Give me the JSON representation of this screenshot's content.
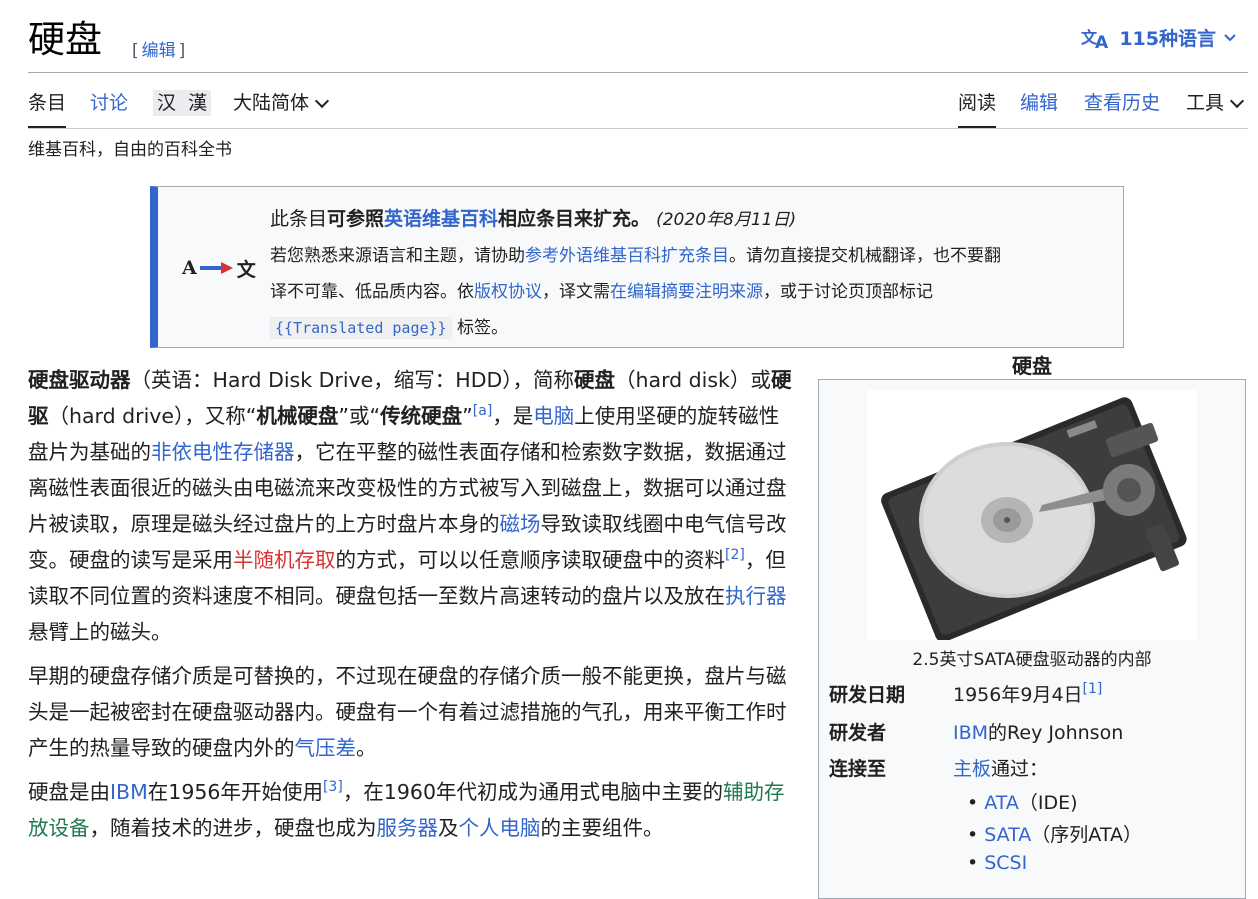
{
  "header": {
    "title": "硬盘",
    "edit_open": "[",
    "edit_label": "编辑",
    "edit_close": "]",
    "languages": "115种语言"
  },
  "tabs": {
    "article": "条目",
    "talk": "讨论",
    "variant_simplified": "汉",
    "variant_traditional": "漢",
    "variant_select": "大陆简体",
    "read": "阅读",
    "edit": "编辑",
    "history": "查看历史",
    "tools": "工具"
  },
  "tagline": "维基百科，自由的百科全书",
  "notice": {
    "icon_a": "A",
    "icon_zh": "文",
    "t1": "此条目",
    "t2": "可参照",
    "t3": "英语维基百科",
    "t4": "相应条目来扩充。",
    "date": "(2020年8月11日)",
    "l1a": "若您熟悉来源语言和主题，请协助",
    "l1b": "参考外语维基百科扩充条目",
    "l1c": "。请勿直接提交机械翻译，也不要翻",
    "l2a": "译不可靠、低品质内容。依",
    "l2b": "版权协议",
    "l2c": "，译文需",
    "l2d": "在编辑摘要注明来源",
    "l2e": "，或于讨论页顶部标记",
    "code": "{{Translated page}}",
    "l3": " 标签。"
  },
  "article": {
    "p1": {
      "a": "硬盘驱动器",
      "b": "（英语：Hard Disk Drive，缩写：HDD），简称",
      "c": "硬盘",
      "d": "（hard disk）或",
      "e": "硬驱",
      "f": "（hard drive），又称“",
      "g": "机械硬盘",
      "h": "”或“",
      "i": "传统硬盘",
      "j": "”",
      "note_a": "[a]",
      "k": "，是",
      "link_computer": "电脑",
      "l": "上使用坚硬的旋转磁性盘片为基础的",
      "link_nvm": "非依电性存储器",
      "m": "，它在平整的磁性表面存储和检索数字数据，数据通过离磁性表面很近的磁头由电磁流来改变极性的方式被写入到磁盘上，数据可以通过盘片被读取，原理是磁头经过盘片的上方时盘片本身的",
      "link_field": "磁场",
      "n": "导致读取线圈中电气信号改变。硬盘的读写是采用",
      "link_sram": "半随机存取",
      "o": "的方式，可以以任意顺序读取硬盘中的资料",
      "ref2": "[2]",
      "p": "，但读取不同位置的资料速度不相同。硬盘包括一至数片高速转动的盘片以及放在",
      "link_actuator": "执行器",
      "q": "悬臂上的磁头。"
    },
    "p2": {
      "a": "早期的硬盘存储介质是可替换的，不过现在硬盘的存储介质一般不能更换，盘片与磁头是一起被密封在硬盘驱动器内。硬盘有一个有着过滤措施的气孔，用来平衡工作时产生的热量导致的硬盘内外的",
      "link_pressure": "气压差",
      "b": "。"
    },
    "p3": {
      "a": "硬盘是由",
      "link_ibm": "IBM",
      "b": "在1956年开始使用",
      "ref3": "[3]",
      "c": "，在1960年代初成为通用式电脑中主要的",
      "link_aux": "辅助存放设备",
      "d": "，随着技术的进步，硬盘也成为",
      "link_server": "服务器",
      "e": "及",
      "link_pc": "个人电脑",
      "f": "的主要组件。"
    }
  },
  "infobox": {
    "caption": "硬盘",
    "image_caption": "2.5英寸SATA硬盘驱动器的内部",
    "rows": [
      {
        "label": "研发日期",
        "value": "1956年9月4日",
        "ref": "[1]"
      },
      {
        "label": "研发者",
        "link": "IBM",
        "value": "的Rey Johnson"
      },
      {
        "label": "连接至",
        "link": "主板",
        "value": "通过："
      }
    ],
    "bullets": [
      {
        "link": "ATA",
        "text": "（IDE)"
      },
      {
        "link": "SATA",
        "text": "（序列ATA）"
      },
      {
        "link": "SCSI",
        "text": ""
      }
    ]
  }
}
